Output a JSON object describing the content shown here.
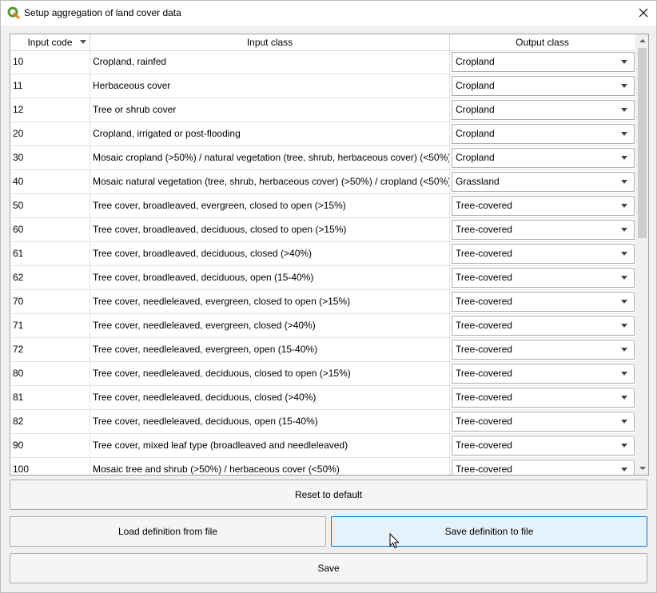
{
  "window": {
    "title": "Setup aggregation of land cover data",
    "app_icon": "qgis-logo-icon"
  },
  "table": {
    "headers": {
      "code": "Input code",
      "input": "Input class",
      "output": "Output class"
    },
    "sort_indicator": "sort-down-icon",
    "rows": [
      {
        "code": "10",
        "input": "Cropland, rainfed",
        "output": "Cropland"
      },
      {
        "code": "11",
        "input": "Herbaceous cover",
        "output": "Cropland"
      },
      {
        "code": "12",
        "input": "Tree or shrub cover",
        "output": "Cropland"
      },
      {
        "code": "20",
        "input": "Cropland, irrigated or post-flooding",
        "output": "Cropland"
      },
      {
        "code": "30",
        "input": "Mosaic cropland (>50%) / natural vegetation (tree, shrub, herbaceous cover) (<50%)",
        "output": "Cropland"
      },
      {
        "code": "40",
        "input": "Mosaic natural vegetation (tree, shrub, herbaceous cover) (>50%) / cropland (<50%)",
        "output": "Grassland"
      },
      {
        "code": "50",
        "input": "Tree cover, broadleaved, evergreen, closed to open (>15%)",
        "output": "Tree-covered"
      },
      {
        "code": "60",
        "input": "Tree cover, broadleaved, deciduous, closed to open (>15%)",
        "output": "Tree-covered"
      },
      {
        "code": "61",
        "input": "Tree cover, broadleaved, deciduous, closed (>40%)",
        "output": "Tree-covered"
      },
      {
        "code": "62",
        "input": "Tree cover, broadleaved, deciduous, open (15-40%)",
        "output": "Tree-covered"
      },
      {
        "code": "70",
        "input": "Tree cover, needleleaved, evergreen, closed to open (>15%)",
        "output": "Tree-covered"
      },
      {
        "code": "71",
        "input": "Tree cover, needleleaved, evergreen, closed (>40%)",
        "output": "Tree-covered"
      },
      {
        "code": "72",
        "input": "Tree cover, needleleaved, evergreen, open (15-40%)",
        "output": "Tree-covered"
      },
      {
        "code": "80",
        "input": "Tree cover, needleleaved, deciduous, closed to open (>15%)",
        "output": "Tree-covered"
      },
      {
        "code": "81",
        "input": "Tree cover, needleleaved, deciduous, closed (>40%)",
        "output": "Tree-covered"
      },
      {
        "code": "82",
        "input": "Tree cover, needleleaved, deciduous, open (15-40%)",
        "output": "Tree-covered"
      },
      {
        "code": "90",
        "input": "Tree cover, mixed leaf type (broadleaved and needleleaved)",
        "output": "Tree-covered"
      },
      {
        "code": "100",
        "input": "Mosaic tree and shrub (>50%) / herbaceous cover (<50%)",
        "output": "Tree-covered"
      }
    ]
  },
  "buttons": {
    "reset": "Reset to default",
    "load": "Load definition from file",
    "save_def": "Save definition to file",
    "save": "Save"
  },
  "colors": {
    "focus_border": "#0078d7",
    "focus_bg": "#e5f1fb",
    "logo_green": "#589632",
    "logo_yellow": "#ee7913"
  }
}
